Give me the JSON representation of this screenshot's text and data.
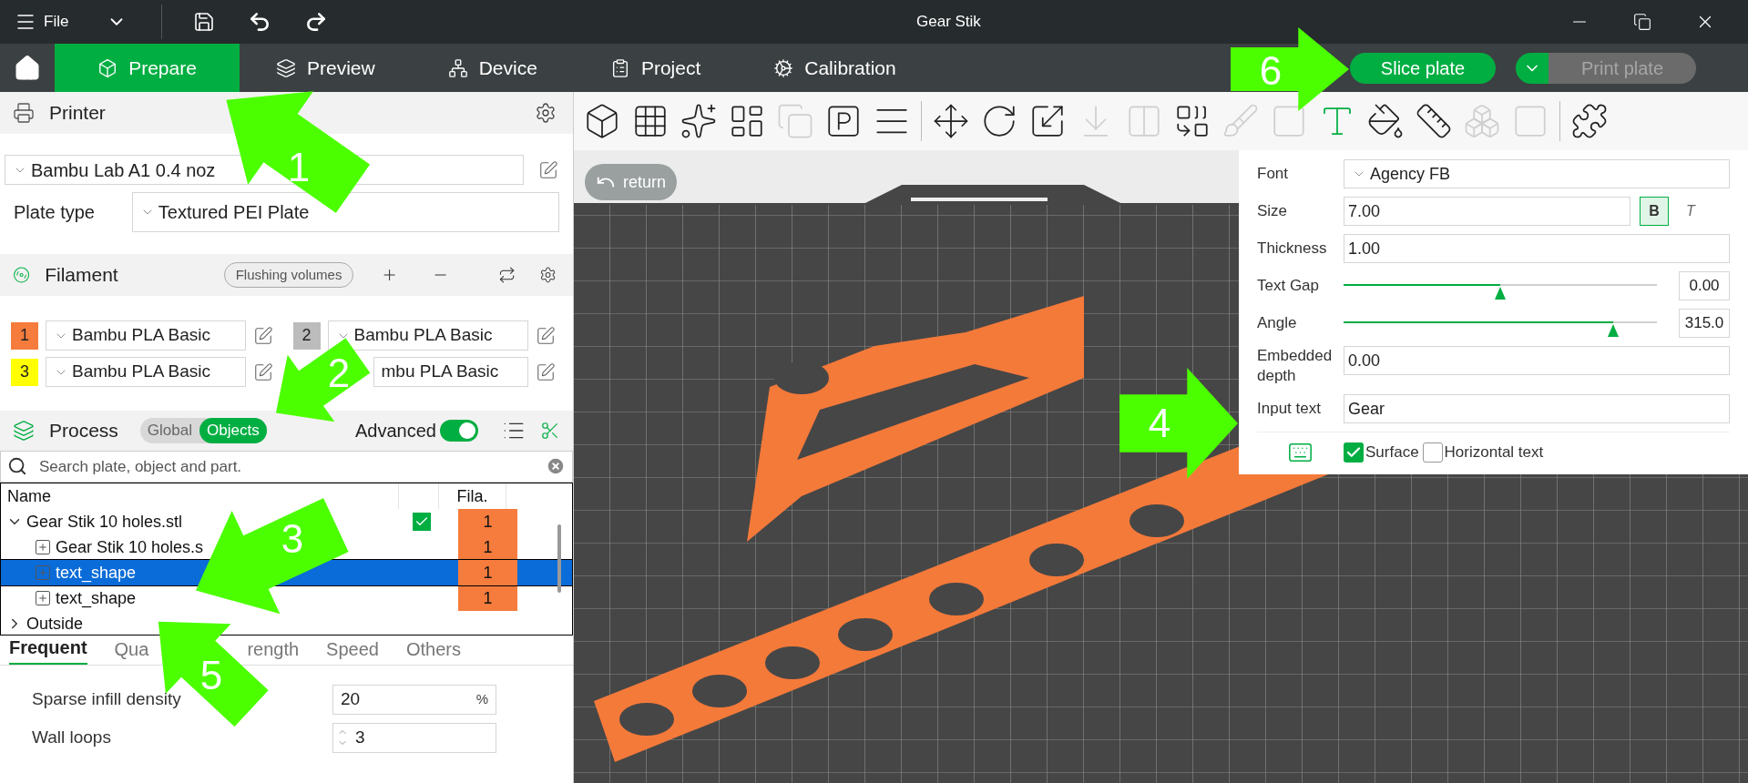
{
  "window": {
    "title": "Gear Stik"
  },
  "menu": {
    "label": "File"
  },
  "nav_tabs": [
    {
      "label": "Prepare",
      "selected": true
    },
    {
      "label": "Preview",
      "selected": false
    },
    {
      "label": "Device",
      "selected": false
    },
    {
      "label": "Project",
      "selected": false
    },
    {
      "label": "Calibration",
      "selected": false
    }
  ],
  "slice_button": {
    "label": "Slice plate"
  },
  "print_button": {
    "label": "Print plate",
    "disabled": true
  },
  "printer": {
    "title": "Printer",
    "preset": "Bambu Lab A1 0.4 noz",
    "plate_type_label": "Plate type",
    "plate_type": "Textured PEI Plate"
  },
  "filament": {
    "title": "Filament",
    "flushing_button": "Flushing volumes",
    "items": [
      {
        "number": "1",
        "color": "#f57c3d",
        "name": "Bambu PLA Basic"
      },
      {
        "number": "2",
        "color": "#bcbcbc",
        "name": "Bambu PLA Basic"
      },
      {
        "number": "3",
        "color": "#ffff00",
        "name": "Bambu PLA Basic"
      },
      {
        "name": "mbu PLA Basic"
      }
    ]
  },
  "process": {
    "title": "Process",
    "scope": [
      {
        "label": "Global",
        "selected": false
      },
      {
        "label": "Objects",
        "selected": true
      }
    ],
    "advanced_label": "Advanced",
    "advanced_on": true,
    "search_placeholder": "Search plate, object and part."
  },
  "object_tree": {
    "columns": [
      "Name",
      "Fila."
    ],
    "rows": [
      {
        "name": "Gear Stik 10 holes.stl",
        "expanded": true,
        "checked": true,
        "filament": "1",
        "selected": false,
        "children": [
          {
            "name": "Gear Stik 10 holes.s",
            "filament": "1",
            "selected": false
          },
          {
            "name": "text_shape",
            "filament": "1",
            "selected": true
          },
          {
            "name": "text_shape",
            "filament": "1",
            "selected": false
          }
        ]
      },
      {
        "name": "Outside",
        "expanded": false,
        "selected": false
      }
    ]
  },
  "settings_tabs": [
    {
      "label": "Frequent",
      "selected": true
    },
    {
      "label": "Qua",
      "selected": false
    },
    {
      "label": "rength",
      "selected": false
    },
    {
      "label": "Speed",
      "selected": false
    },
    {
      "label": "Others",
      "selected": false
    }
  ],
  "settings": [
    {
      "kind": "unit",
      "label": "Sparse infill density",
      "value": "20",
      "unit": "%"
    },
    {
      "kind": "spin",
      "label": "Wall loops",
      "value": "3"
    }
  ],
  "viewport": {
    "return_button": "return"
  },
  "toolbar": [
    {
      "disabled": false
    },
    {
      "disabled": false
    },
    {
      "disabled": false
    },
    {
      "disabled": false
    },
    {
      "disabled": true
    },
    {
      "disabled": false
    },
    {
      "disabled": false
    },
    {
      "disabled": false
    },
    {
      "disabled": false
    },
    {
      "disabled": false
    },
    {
      "disabled": true
    },
    {
      "disabled": true
    },
    {
      "disabled": false
    },
    {
      "disabled": true
    },
    {
      "disabled": true
    },
    {
      "disabled": false
    },
    {
      "disabled": false
    },
    {
      "disabled": false
    },
    {
      "disabled": true
    },
    {
      "disabled": true
    },
    {
      "disabled": false
    }
  ],
  "text_tool": {
    "font_label": "Font",
    "font": "Agency FB",
    "size_label": "Size",
    "size": "7.00",
    "bold": {
      "label": "B",
      "selected": true
    },
    "italic": {
      "label": "T",
      "selected": false
    },
    "thickness_label": "Thickness",
    "thickness": "1.00",
    "gap_label": "Text Gap",
    "gap": {
      "level": 0.5,
      "reading": "0.00"
    },
    "angle_label": "Angle",
    "angle": {
      "level": 0.86,
      "reading": "315.0"
    },
    "depth_label": "Embedded depth",
    "depth": "0.00",
    "input_label": "Input text",
    "input": "Gear",
    "surface": {
      "label": "Surface",
      "checked": true
    },
    "horizontal": {
      "label": "Horizontal text",
      "checked": false
    }
  },
  "annotations": [
    {
      "number": "1"
    },
    {
      "number": "2"
    },
    {
      "number": "3"
    },
    {
      "number": "4"
    },
    {
      "number": "5"
    },
    {
      "number": "6"
    }
  ]
}
